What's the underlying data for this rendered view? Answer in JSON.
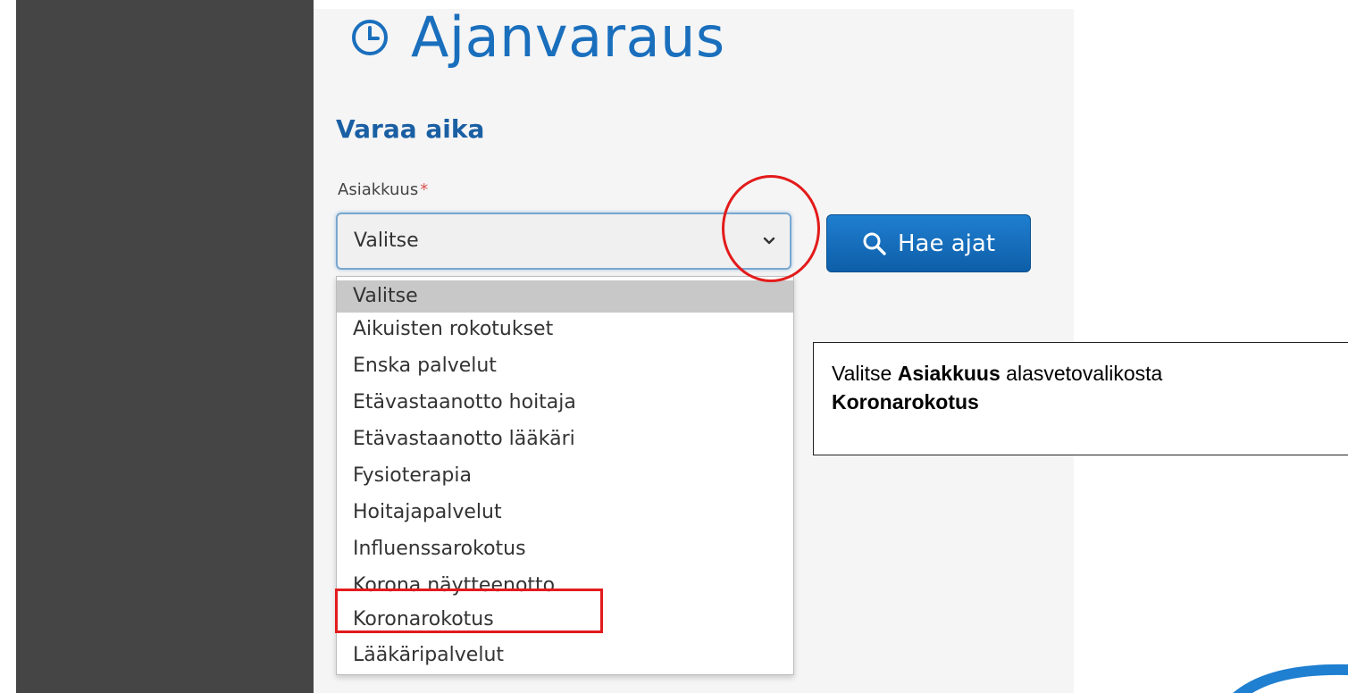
{
  "header": {
    "title": "Ajanvaraus",
    "icon": "clock-icon"
  },
  "form": {
    "section_title": "Varaa aika",
    "customer_label": "Asiakkuus",
    "required_marker": "*",
    "select_value": "Valitse",
    "search_button_label": "Hae ajat",
    "search_icon": "search-icon"
  },
  "dropdown": {
    "options": [
      "Valitse",
      "Aikuisten rokotukset",
      "Enska palvelut",
      "Etävastaanotto hoitaja",
      "Etävastaanotto lääkäri",
      "Fysioterapia",
      "Hoitajapalvelut",
      "Influenssarokotus",
      "Korona näytteenotto",
      "Koronarokotus",
      "Lääkäripalvelut"
    ],
    "highlighted": "Valitse"
  },
  "instruction": {
    "prefix": "Valitse ",
    "field": "Asiakkuus",
    "middle": " alasvetovalikosta",
    "target": "Koronarokotus"
  },
  "colors": {
    "accent": "#1a6fbd",
    "button": "#1170c2",
    "annotation": "#e31b1b",
    "sidebar": "#454545"
  }
}
